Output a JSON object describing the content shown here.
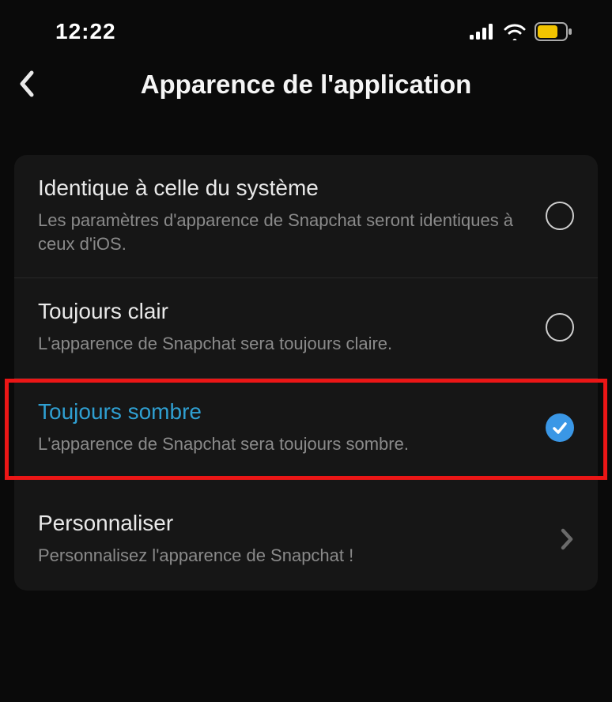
{
  "status": {
    "time": "12:22"
  },
  "header": {
    "title": "Apparence de l'application"
  },
  "options": {
    "system": {
      "title": "Identique à celle du système",
      "desc": "Les paramètres d'apparence de Snapchat seront identiques à ceux d'iOS."
    },
    "light": {
      "title": "Toujours clair",
      "desc": "L'apparence de Snapchat sera toujours claire."
    },
    "dark": {
      "title": "Toujours sombre",
      "desc": "L'apparence de Snapchat sera toujours sombre."
    },
    "customize": {
      "title": "Personnaliser",
      "desc": "Personnalisez l'apparence de Snapchat !"
    }
  }
}
